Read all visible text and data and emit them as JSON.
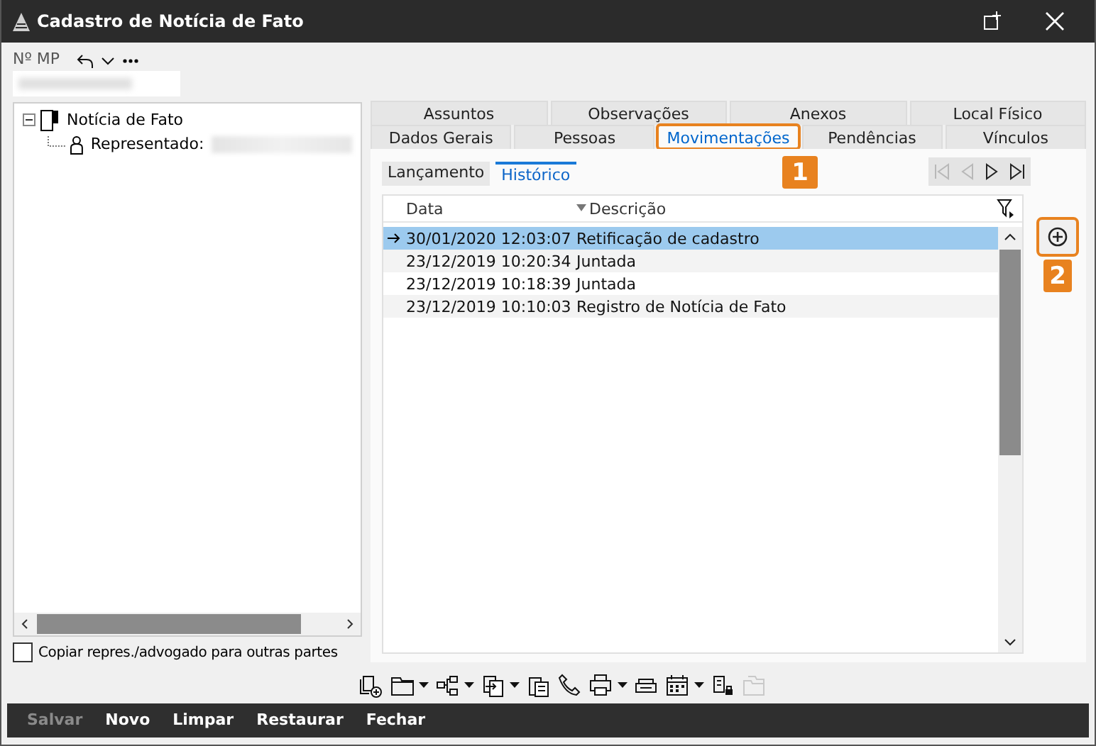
{
  "window": {
    "title": "Cadastro de Notícia de Fato"
  },
  "header": {
    "label": "Nº MP"
  },
  "tree": [
    {
      "label": "Notícia de Fato",
      "expanded": true,
      "children": [
        {
          "label": "Representado:"
        }
      ]
    }
  ],
  "copy_checkbox": {
    "label": "Copiar repres./advogado para outras partes",
    "checked": false
  },
  "tabs": [
    [
      {
        "label": "Assuntos",
        "selected": false
      },
      {
        "label": "Observações",
        "selected": false
      },
      {
        "label": "Anexos",
        "selected": false
      },
      {
        "label": "Local Físico",
        "selected": false
      }
    ],
    [
      {
        "label": "Dados Gerais",
        "selected": false
      },
      {
        "label": "Pessoas",
        "selected": false
      },
      {
        "label": "Movimentações",
        "selected": true
      },
      {
        "label": "Pendências",
        "selected": false
      },
      {
        "label": "Vínculos",
        "selected": false
      }
    ]
  ],
  "subtabs": [
    {
      "label": "Lançamento",
      "selected": false
    },
    {
      "label": "Histórico",
      "selected": true
    }
  ],
  "table": {
    "columns": [
      {
        "label": "Data",
        "sorted": false
      },
      {
        "label": "Descrição",
        "sorted": true
      }
    ],
    "rows": [
      {
        "cells": [
          "30/01/2020 12:03:07",
          "Retificação de cadastro"
        ],
        "selected": true
      },
      {
        "cells": [
          "23/12/2019 10:20:34",
          "Juntada"
        ],
        "selected": false
      },
      {
        "cells": [
          "23/12/2019 10:18:39",
          "Juntada"
        ],
        "selected": false
      },
      {
        "cells": [
          "23/12/2019 10:10:03",
          "Registro de Notícia de Fato"
        ],
        "selected": false
      }
    ]
  },
  "annotations": [
    "1",
    "2"
  ],
  "toolbar": [
    {
      "kind": "add-doc",
      "dropdown": false,
      "disabled": false
    },
    {
      "kind": "folder",
      "dropdown": true,
      "disabled": false
    },
    {
      "kind": "tree",
      "dropdown": true,
      "disabled": false
    },
    {
      "kind": "transfer",
      "dropdown": true,
      "disabled": false
    },
    {
      "kind": "clipboard",
      "dropdown": false,
      "disabled": false
    },
    {
      "kind": "phone",
      "dropdown": false,
      "disabled": false
    },
    {
      "kind": "printer",
      "dropdown": true,
      "disabled": false
    },
    {
      "kind": "scanner",
      "dropdown": false,
      "disabled": false
    },
    {
      "kind": "calendar",
      "dropdown": true,
      "disabled": false
    },
    {
      "kind": "lock-doc",
      "dropdown": false,
      "disabled": false
    },
    {
      "kind": "folders",
      "dropdown": false,
      "disabled": true
    }
  ],
  "buttons": [
    {
      "label": "Salvar",
      "disabled": true
    },
    {
      "label": "Novo",
      "disabled": false
    },
    {
      "label": "Limpar",
      "disabled": false
    },
    {
      "label": "Restaurar",
      "disabled": false
    },
    {
      "label": "Fechar",
      "disabled": false
    }
  ]
}
